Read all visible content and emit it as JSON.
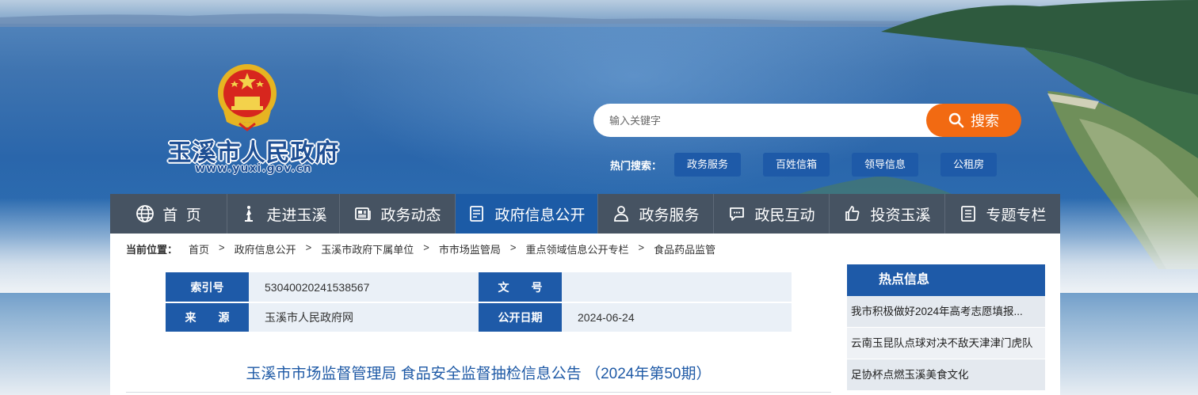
{
  "site": {
    "title": "玉溪市人民政府",
    "url": "www.yuxi.gov.cn"
  },
  "search": {
    "placeholder": "输入关键字",
    "button_label": "搜索",
    "hot_label": "热门搜索：",
    "hot_tags": [
      "政务服务",
      "百姓信箱",
      "领导信息",
      "公租房"
    ]
  },
  "nav": {
    "items": [
      {
        "label": "首  页",
        "icon": "globe-icon"
      },
      {
        "label": "走进玉溪",
        "icon": "statue-icon"
      },
      {
        "label": "政务动态",
        "icon": "newspaper-icon"
      },
      {
        "label": "政府信息公开",
        "icon": "document-icon"
      },
      {
        "label": "政务服务",
        "icon": "person-icon"
      },
      {
        "label": "政民互动",
        "icon": "chat-icon"
      },
      {
        "label": "投资玉溪",
        "icon": "thumbs-up-icon"
      },
      {
        "label": "专题专栏",
        "icon": "list-icon"
      }
    ],
    "active_index": 3
  },
  "breadcrumb": {
    "prefix": "当前位置：",
    "items": [
      "首页",
      "政府信息公开",
      "玉溪市政府下属单位",
      "市市场监管局",
      "重点领域信息公开专栏",
      "食品药品监管"
    ]
  },
  "meta": {
    "index_label": "索引号",
    "index_value": "53040020241538567",
    "doc_no_label": "文　　号",
    "doc_no_value": "",
    "source_label": "来　　源",
    "source_value": "玉溪市人民政府网",
    "date_label": "公开日期",
    "date_value": "2024-06-24"
  },
  "article": {
    "title": "玉溪市市场监督管理局 食品安全监督抽检信息公告 （2024年第50期）"
  },
  "sidebar": {
    "heading": "热点信息",
    "items": [
      "我市积极做好2024年高考志愿填报...",
      "云南玉昆队点球对决不敌天津津门虎队",
      "足协杯点燃玉溪美食文化"
    ]
  },
  "colors": {
    "primary": "#1e5aa8",
    "nav_bg": "#465362",
    "search_button": "#f26a12",
    "meta_value_bg": "#eaf0f7"
  }
}
